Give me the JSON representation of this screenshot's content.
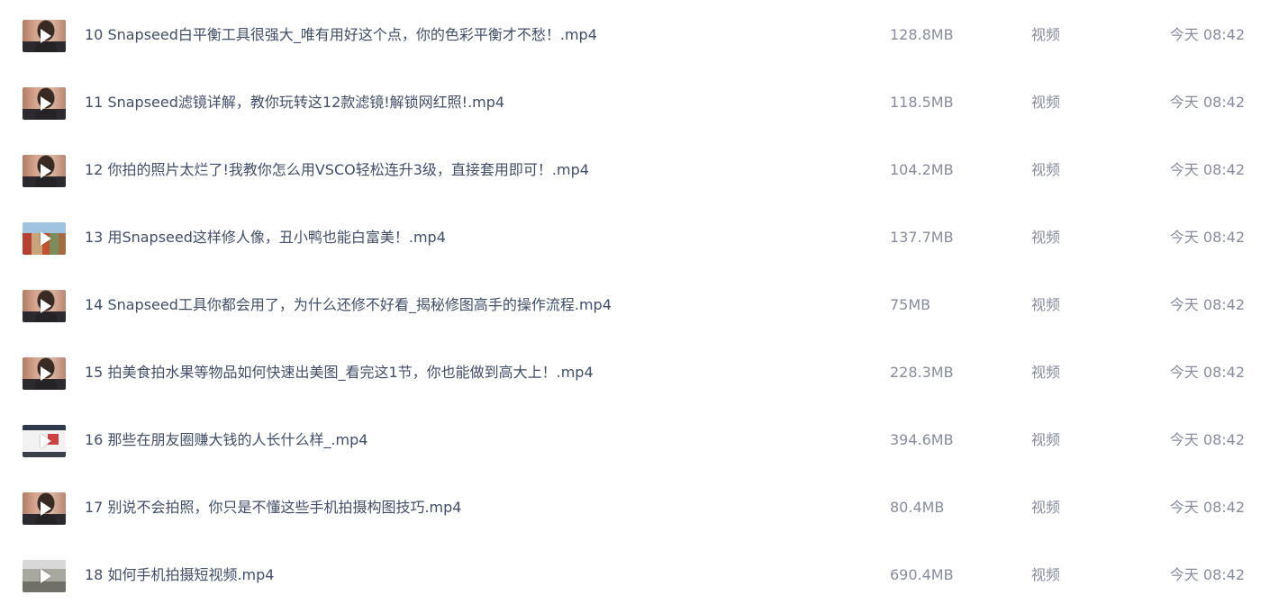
{
  "files": [
    {
      "name": "10 Snapseed白平衡工具很强大_唯有用好这个点，你的色彩平衡才不愁！.mp4",
      "size": "128.8MB",
      "type": "视频",
      "time": "今天 08:42",
      "thumb": "portrait"
    },
    {
      "name": "11 Snapseed滤镜详解，教你玩转这12款滤镜!解锁网红照!.mp4",
      "size": "118.5MB",
      "type": "视频",
      "time": "今天 08:42",
      "thumb": "portrait"
    },
    {
      "name": "12 你拍的照片太烂了!我教你怎么用VSCO轻松连升3级，直接套用即可！.mp4",
      "size": "104.2MB",
      "type": "视频",
      "time": "今天 08:42",
      "thumb": "portrait"
    },
    {
      "name": "13 用Snapseed这样修人像，丑小鸭也能白富美！.mp4",
      "size": "137.7MB",
      "type": "视频",
      "time": "今天 08:42",
      "thumb": "outdoor"
    },
    {
      "name": "14 Snapseed工具你都会用了，为什么还修不好看_揭秘修图高手的操作流程.mp4",
      "size": "75MB",
      "type": "视频",
      "time": "今天 08:42",
      "thumb": "portrait"
    },
    {
      "name": "15 拍美食拍水果等物品如何快速出美图_看完这1节，你也能做到高大上！.mp4",
      "size": "228.3MB",
      "type": "视频",
      "time": "今天 08:42",
      "thumb": "portrait"
    },
    {
      "name": "16 那些在朋友圈赚大钱的人长什么样_.mp4",
      "size": "394.6MB",
      "type": "视频",
      "time": "今天 08:42",
      "thumb": "screen"
    },
    {
      "name": "17 别说不会拍照，你只是不懂这些手机拍摄构图技巧.mp4",
      "size": "80.4MB",
      "type": "视频",
      "time": "今天 08:42",
      "thumb": "portrait"
    },
    {
      "name": "18 如何手机拍摄短视频.mp4",
      "size": "690.4MB",
      "type": "视频",
      "time": "今天 08:42",
      "thumb": "street"
    }
  ]
}
